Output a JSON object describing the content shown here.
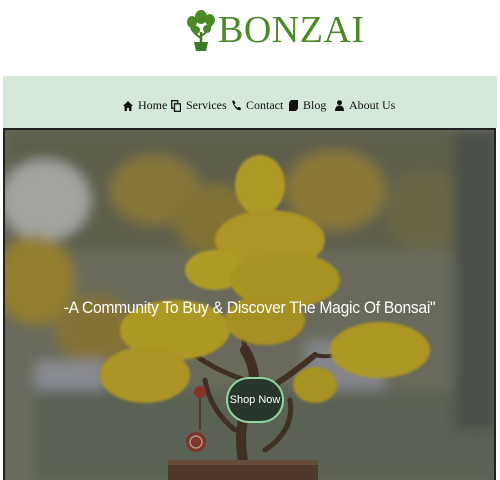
{
  "brand": {
    "name": "BONZAI",
    "logo_icon": "bonsai-tree-icon",
    "color": "#4c8a28"
  },
  "nav": {
    "background": "#d6e8da",
    "items": [
      {
        "label": "Home",
        "icon": "home-icon"
      },
      {
        "label": "Services",
        "icon": "copy-icon"
      },
      {
        "label": "Contact",
        "icon": "phone-icon"
      },
      {
        "label": "Blog",
        "icon": "document-icon"
      },
      {
        "label": "About Us",
        "icon": "user-icon"
      }
    ]
  },
  "hero": {
    "tagline": "-A Community To Buy & Discover The Magic Of Bonsai\"",
    "cta_label": "Shop Now",
    "cta_color": "#29362c",
    "cta_border": "#8fd6a0",
    "image": "yellow-blossom-bonsai-photo"
  }
}
